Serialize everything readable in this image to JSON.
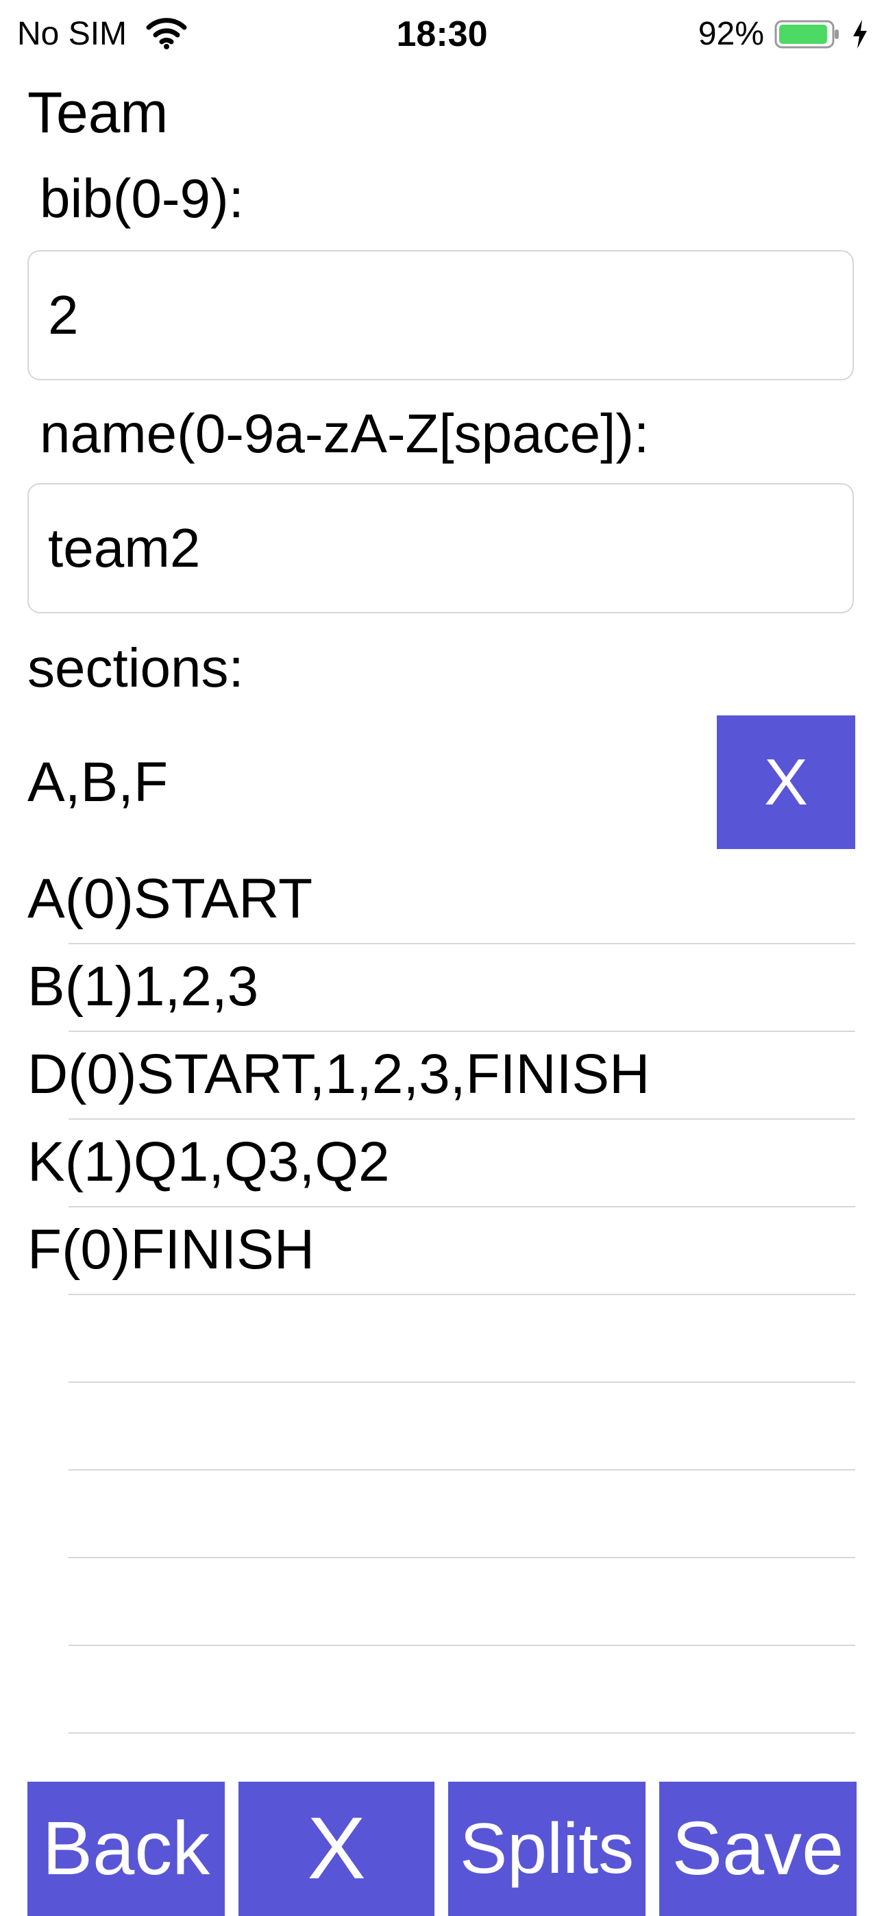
{
  "status_bar": {
    "carrier": "No SIM",
    "time": "18:30",
    "battery_percent": "92%",
    "battery_level": 0.92,
    "battery_color": "#4cd964",
    "icons": [
      "wifi-icon",
      "battery-icon",
      "charging-bolt-icon"
    ]
  },
  "page": {
    "title": "Team"
  },
  "form": {
    "bib_label": "bib(0-9):",
    "bib_value": "2",
    "name_label": "name(0-9a-zA-Z[space]):",
    "name_value": "team2",
    "sections_label": "sections:",
    "selected_sections": "A,B,F",
    "clear_sections_label": "X"
  },
  "section_list": [
    "A(0)START",
    "B(1)1,2,3",
    "D(0)START,1,2,3,FINISH",
    "K(1)Q1,Q3,Q2",
    "F(0)FINISH",
    "",
    "",
    "",
    "",
    ""
  ],
  "toolbar": {
    "back_label": "Back",
    "x_label": "X",
    "splits_label": "Splits",
    "save_label": "Save"
  },
  "colors": {
    "accent": "#5856d6",
    "separator": "#d8d8d8",
    "input_border": "#d6d6d6"
  }
}
